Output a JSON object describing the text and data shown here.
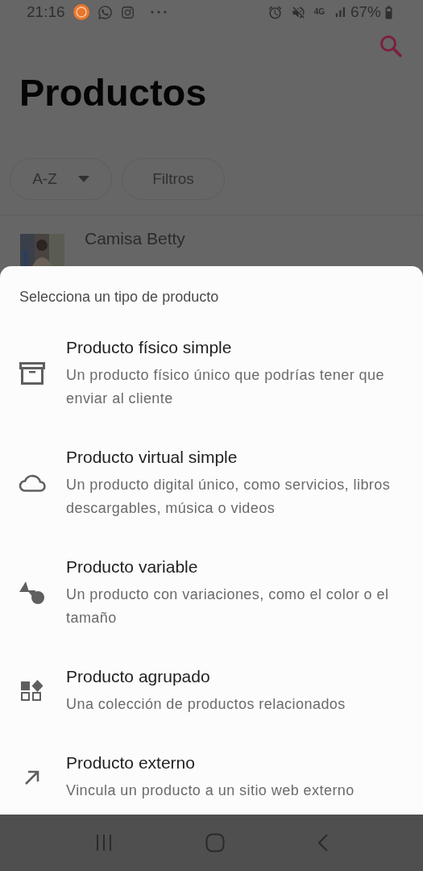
{
  "status_bar": {
    "time": "21:16",
    "network": "4G",
    "battery": "67%"
  },
  "header": {
    "title": "Productos"
  },
  "sort_chip": {
    "label": "A-Z"
  },
  "filter_chip": {
    "label": "Filtros"
  },
  "products": [
    {
      "name": "Camisa Betty"
    }
  ],
  "sheet": {
    "title": "Selecciona un tipo de producto",
    "options": [
      {
        "kind": "physical",
        "title": "Producto físico simple",
        "description": "Un producto físico único que podrías tener que enviar al cliente"
      },
      {
        "kind": "virtual",
        "title": "Producto virtual simple",
        "description": "Un producto digital único, como servicios, libros descargables, música o videos"
      },
      {
        "kind": "variable",
        "title": "Producto variable",
        "description": "Un producto con variaciones, como el color o el tamaño"
      },
      {
        "kind": "grouped",
        "title": "Producto agrupado",
        "description": "Una colección de productos relacionados"
      },
      {
        "kind": "external",
        "title": "Producto externo",
        "description": "Vincula un producto a un sitio web externo"
      }
    ]
  }
}
